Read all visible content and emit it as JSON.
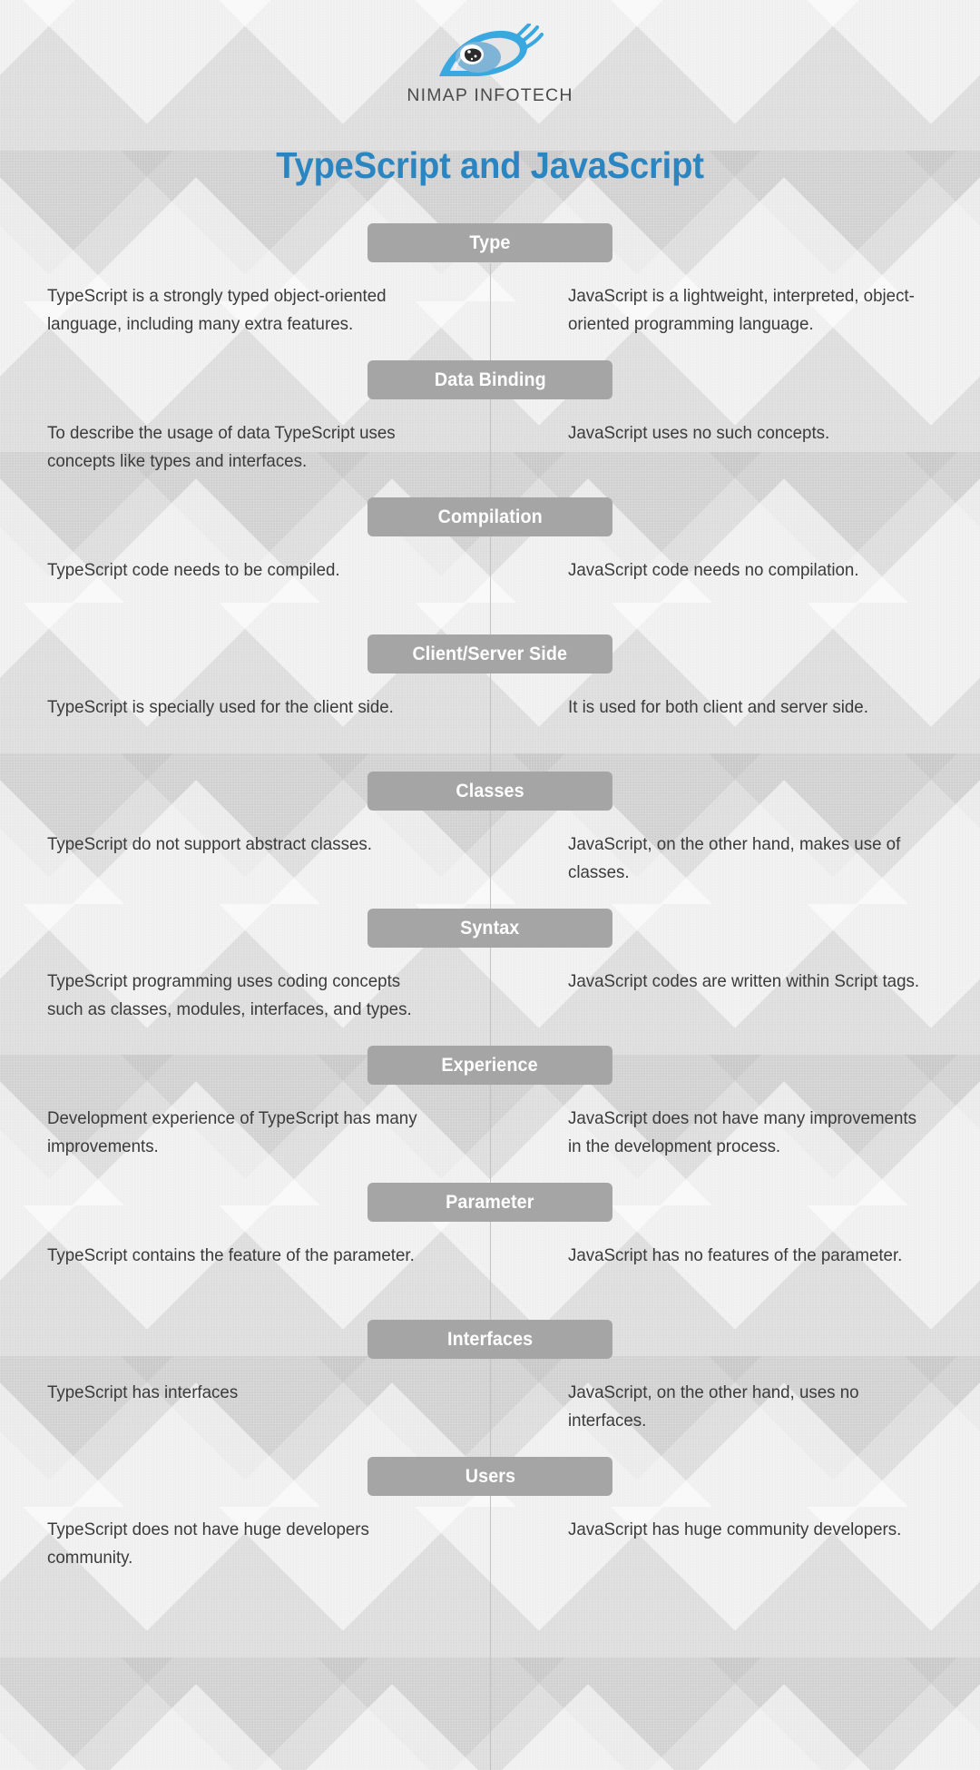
{
  "brand": {
    "wordmark": "NIMAP INFOTECH",
    "logo_icon": "eye-icon",
    "logo_blue": "#3aa8e0",
    "iris_blue": "#7fb4d6"
  },
  "title": "TypeScript and JavaScript",
  "accent_color": "#2a85c0",
  "header_badge_color": "#a5a5a5",
  "background_color": "#dcdcdc",
  "text_color": "#3b3b3b",
  "rows": [
    {
      "header": "Type",
      "left": "TypeScript is a strongly typed object-oriented language, including many extra features.",
      "right": "JavaScript is a lightweight, interpreted, object-oriented programming language."
    },
    {
      "header": "Data Binding",
      "left": "To describe the usage of data TypeScript uses concepts like types and interfaces.",
      "right": "JavaScript uses no such concepts."
    },
    {
      "header": "Compilation",
      "left": "TypeScript code needs to be compiled.",
      "right": "JavaScript code needs no compilation."
    },
    {
      "header": "Client/Server Side",
      "left": "TypeScript is specially used for the client side.",
      "right": "It is used for both client and server side."
    },
    {
      "header": "Classes",
      "left": "TypeScript do not support abstract classes.",
      "right": "JavaScript, on the other hand, makes use of classes."
    },
    {
      "header": "Syntax",
      "left": "TypeScript programming uses coding concepts such as classes, modules, interfaces, and types.",
      "right": "JavaScript codes are written within Script tags."
    },
    {
      "header": "Experience",
      "left": "Development experience of TypeScript has many improvements.",
      "right": "JavaScript does not have many improvements in the development process."
    },
    {
      "header": "Parameter",
      "left": "TypeScript contains the feature of the parameter.",
      "right": "JavaScript has no features of the parameter."
    },
    {
      "header": "Interfaces",
      "left": "TypeScript has interfaces",
      "right": "JavaScript, on the other hand, uses no interfaces."
    },
    {
      "header": "Users",
      "left": "TypeScript does not have huge developers community.",
      "right": "JavaScript has huge community developers."
    }
  ]
}
